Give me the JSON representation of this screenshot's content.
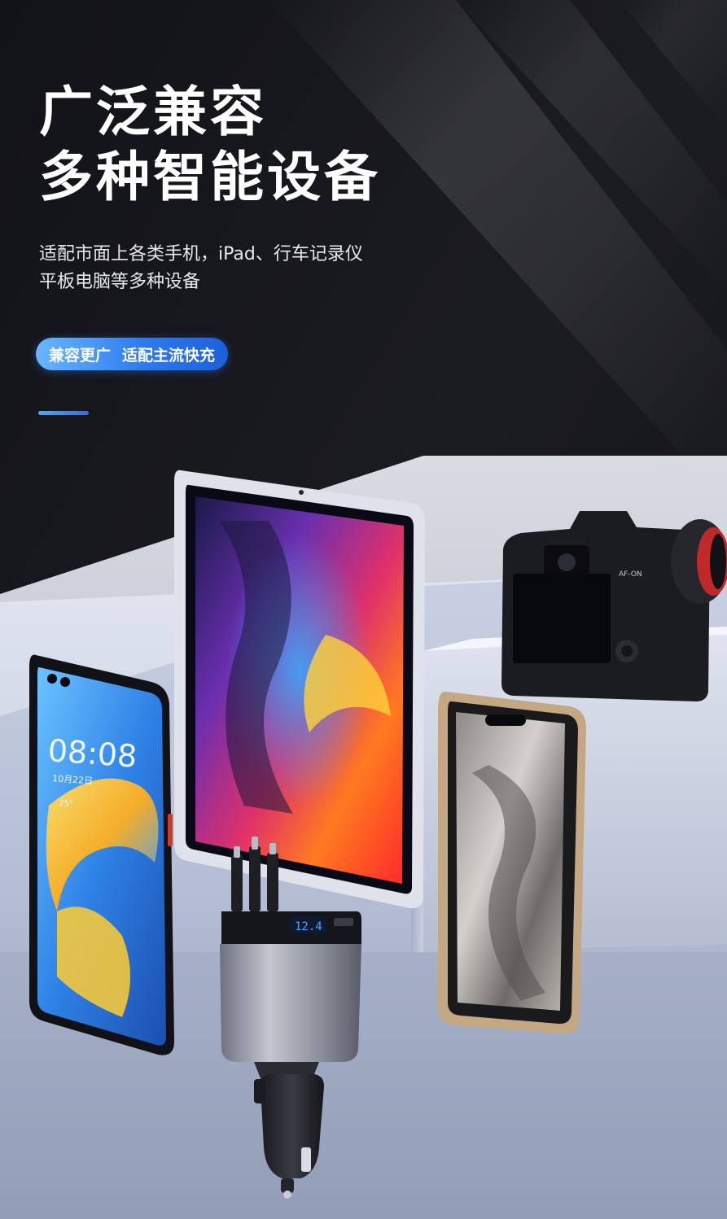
{
  "headline": {
    "line1": "广泛兼容",
    "line2": "多种智能设备"
  },
  "subtitle": {
    "line1": "适配市面上各类手机，iPad、行车记录仪",
    "line2": "平板电脑等多种设备"
  },
  "badge": {
    "part1": "兼容更广",
    "part2": "适配主流快充"
  },
  "devices": {
    "phone_left_time": "08:08",
    "phone_left_date": "10月22日",
    "phone_left_temp": "25°",
    "charger_display": "12.4",
    "camera_label": "AF-ON"
  },
  "colors": {
    "background": "#0c0d11",
    "badge_gradient_start": "#6ab6ff",
    "badge_gradient_end": "#1e5fd8",
    "text_primary": "#ffffff"
  }
}
